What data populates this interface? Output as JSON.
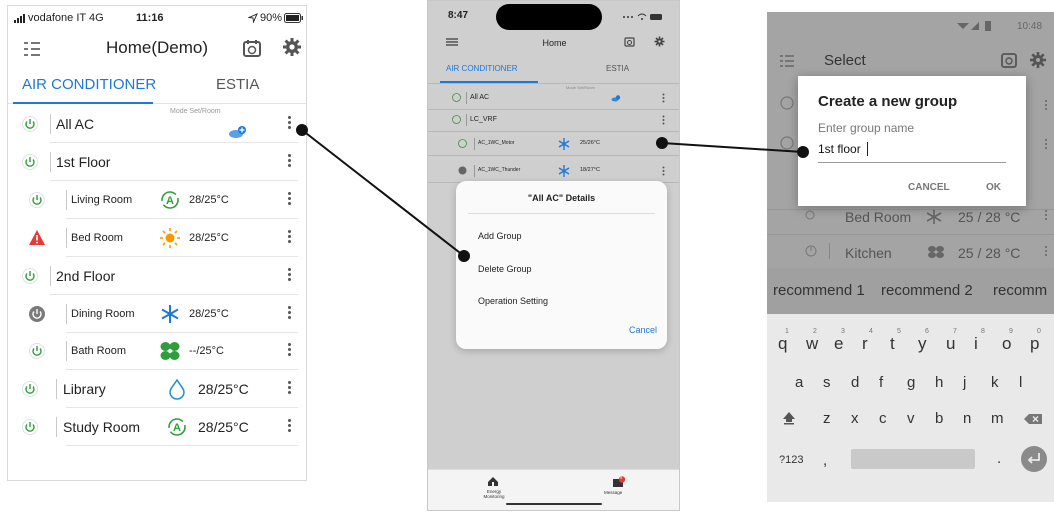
{
  "colors": {
    "accent": "#1e78d7",
    "alert": "#e53935",
    "sun": "#ff9800",
    "fan": "#2e9e3a",
    "snow": "#1e78d7",
    "drop": "#1e90c8"
  },
  "phone1": {
    "status": {
      "carrier": "vodafone IT  4G",
      "time": "11:16",
      "battery": "90%"
    },
    "title": "Home(Demo)",
    "tabs": [
      "AIR CONDITIONER",
      "ESTIA"
    ],
    "mode_header": "Mode  Set/Room",
    "rows": [
      {
        "name": "All AC",
        "icon": "power-icon",
        "temp": ""
      },
      {
        "name": "1st Floor",
        "icon": "power-icon",
        "temp": ""
      },
      {
        "name": "Living Room",
        "icon": "power-icon",
        "mode": "auto-mode-icon",
        "temp": "28/25°C"
      },
      {
        "name": "Bed Room",
        "icon": "warning-icon",
        "mode": "sun-icon",
        "temp": "28/25°C"
      },
      {
        "name": "2nd Floor",
        "icon": "power-icon",
        "temp": ""
      },
      {
        "name": "Dining Room",
        "icon": "power-off-icon",
        "mode": "snowflake-icon",
        "temp": "28/25°C"
      },
      {
        "name": "Bath Room",
        "icon": "power-icon",
        "mode": "fan-icon",
        "temp": "--/25°C"
      },
      {
        "name": "Library",
        "icon": "power-icon",
        "mode": "drop-icon",
        "temp": "28/25°C"
      },
      {
        "name": "Study Room",
        "icon": "power-icon",
        "mode": "auto-mode-icon",
        "temp": "28/25°C"
      }
    ]
  },
  "phone2": {
    "time": "8:47",
    "title": "Home",
    "tabs": [
      "AIR CONDITIONER",
      "ESTIA"
    ],
    "mode_header": "Mode  Set/Room",
    "rows": [
      {
        "name": "All AC",
        "temp": ""
      },
      {
        "name": "LC_VRF",
        "temp": ""
      },
      {
        "name": "AC_1WC_Motor",
        "temp": "25/26°C"
      },
      {
        "name": "AC_1WC_Thunder",
        "temp": "18/27°C"
      }
    ],
    "dialog": {
      "title": "\"All AC\" Details",
      "options": [
        "Add Group",
        "Delete Group",
        "Operation Setting"
      ],
      "cancel": "Cancel"
    },
    "tabbar": {
      "energy": "Energy\nMonitoring",
      "message": "Message",
      "badge": "4"
    }
  },
  "phone3": {
    "status_time": "10:48",
    "title": "Select",
    "dialog": {
      "title": "Create a new group",
      "placeholder": "Enter group name",
      "value": "1st floor",
      "cancel": "CANCEL",
      "ok": "OK"
    },
    "bg_rows": [
      {
        "name": "Bed Room",
        "temp": "25 / 28 °C"
      },
      {
        "name": "Kitchen",
        "temp": "25 / 28 °C"
      }
    ],
    "suggestions": [
      "recommend 1",
      "recommend 2",
      "recomm"
    ],
    "keys": {
      "row1": [
        "q",
        "w",
        "e",
        "r",
        "t",
        "y",
        "u",
        "i",
        "o",
        "p"
      ],
      "row1_digits": [
        "1",
        "2",
        "3",
        "4",
        "5",
        "6",
        "7",
        "8",
        "9",
        "0"
      ],
      "row2": [
        "a",
        "s",
        "d",
        "f",
        "g",
        "h",
        "j",
        "k",
        "l"
      ],
      "row3": [
        "z",
        "x",
        "c",
        "v",
        "b",
        "n",
        "m"
      ],
      "sym": "?123",
      "comma": ",",
      "period": "."
    }
  }
}
